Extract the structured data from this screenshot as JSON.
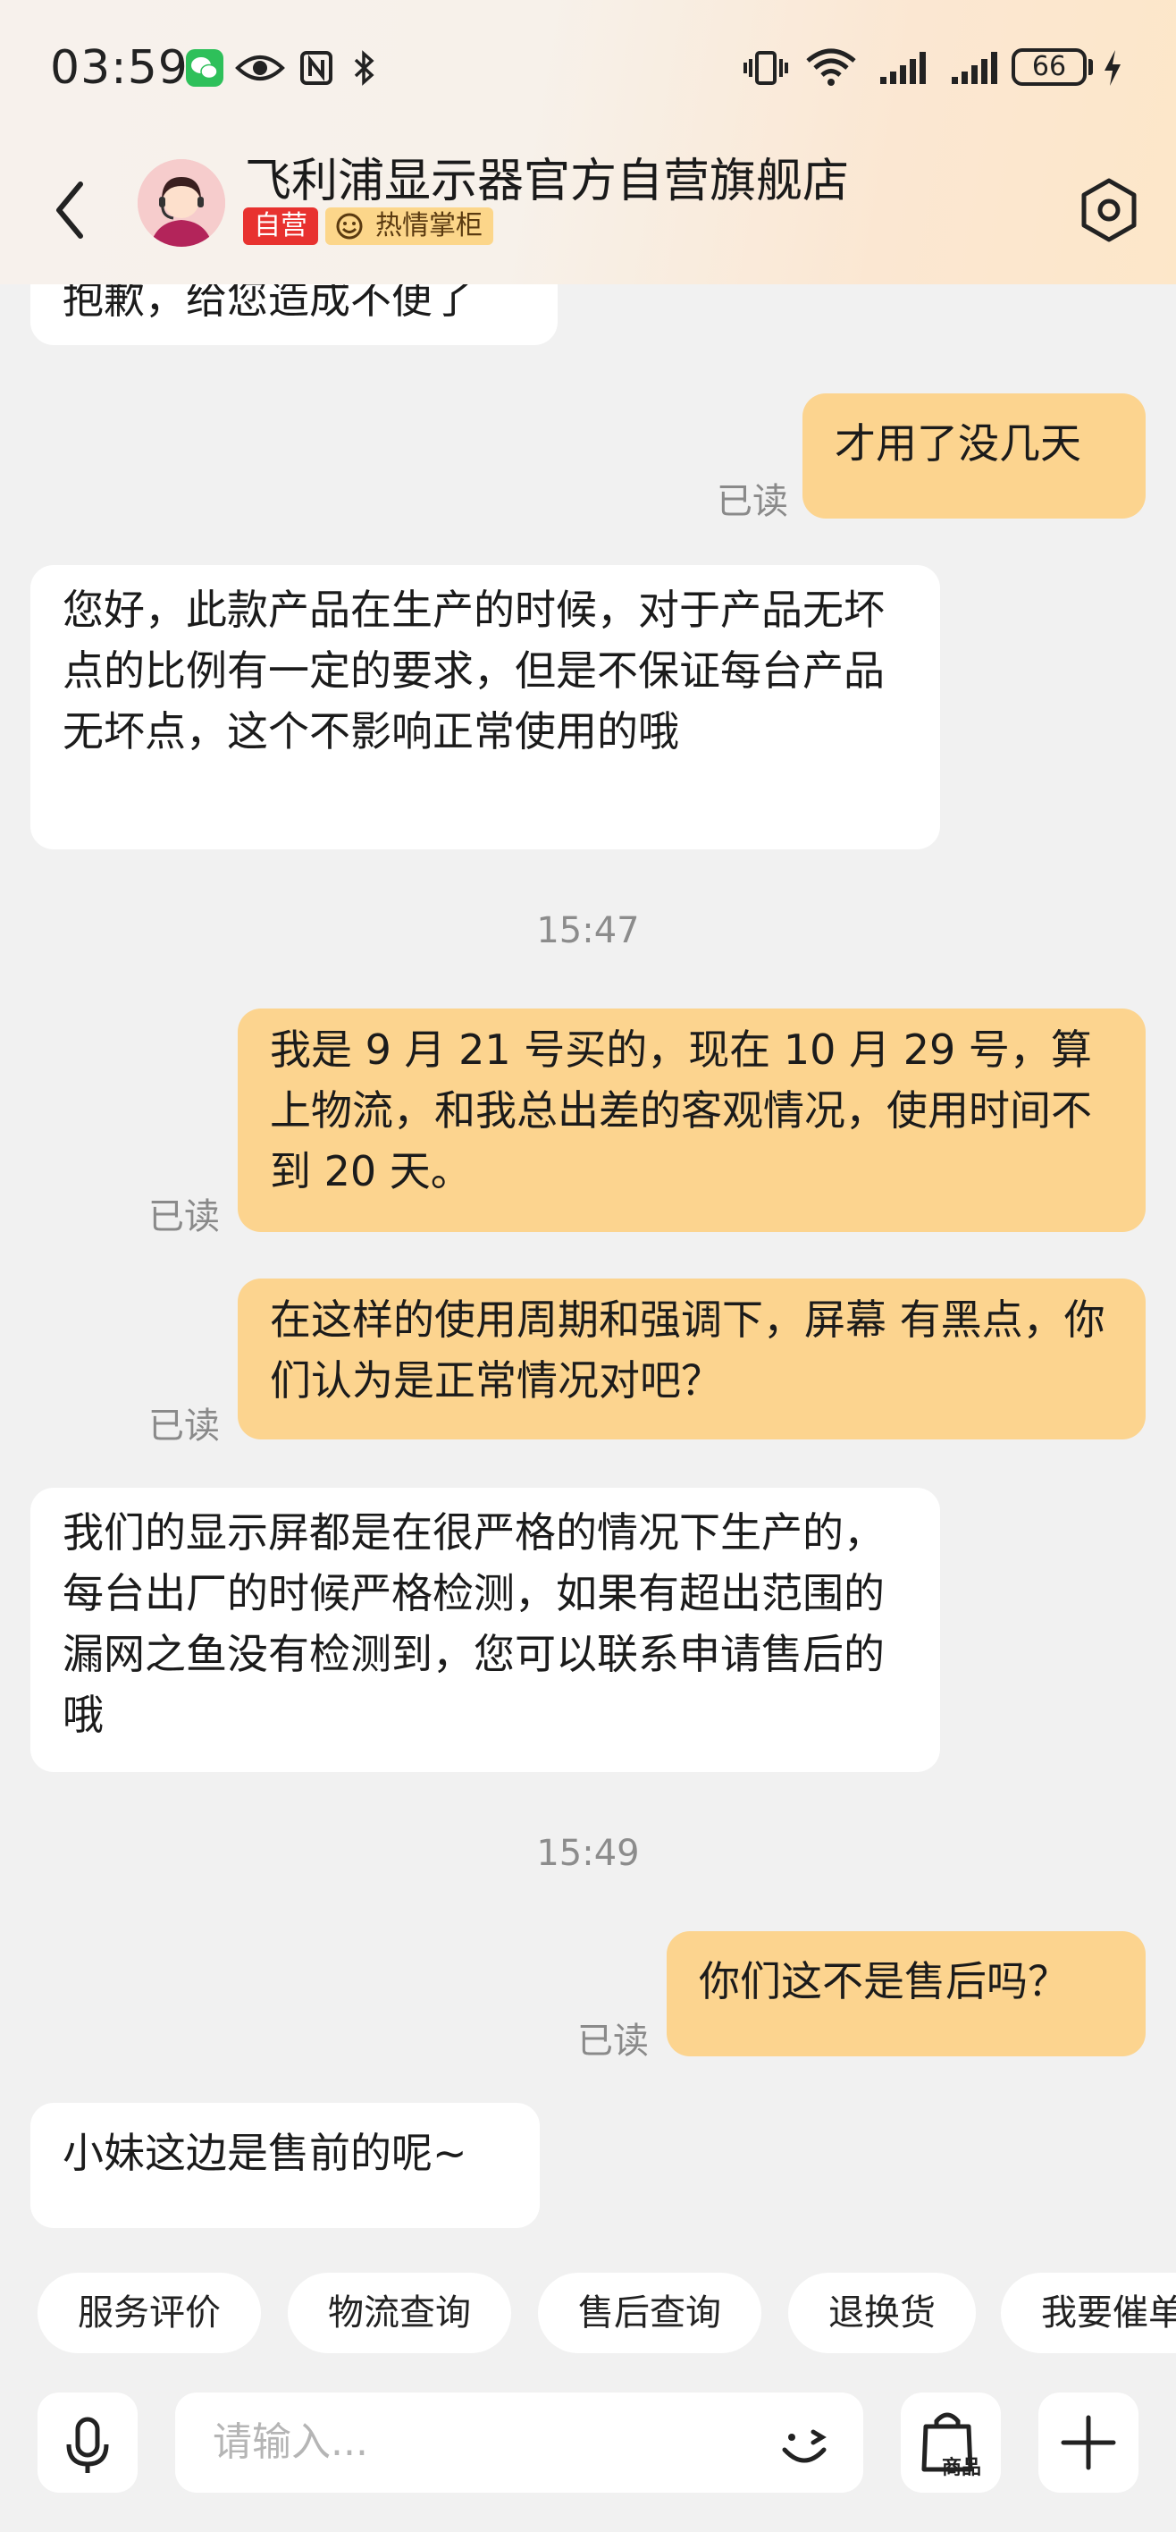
{
  "status_bar": {
    "time": "03:59",
    "battery": "66",
    "icons": [
      "wechat-icon",
      "eye-icon",
      "nfc-icon",
      "bluetooth-icon",
      "vibrate-icon",
      "wifi-icon",
      "signal-icon",
      "signal-icon",
      "charging-icon"
    ]
  },
  "header": {
    "title": "飞利浦显示器官方自营旗舰店",
    "badge_self": "自营",
    "badge_hot": "热情掌柜"
  },
  "messages": [
    {
      "side": "left",
      "text": "抱歉，给您造成不便了"
    },
    {
      "side": "right",
      "text": "才用了没几天",
      "read": "已读"
    },
    {
      "side": "left",
      "text": "您好，此款产品在生产的时候，对于产品无坏点的比例有一定的要求，但是不保证每台产品无坏点，这个不影响正常使用的哦"
    },
    {
      "type": "time",
      "text": "15:47"
    },
    {
      "side": "right",
      "text": "我是 9 月 21 号买的，现在 10 月 29 号，算上物流，和我总出差的客观情况，使用时间不到 20 天。",
      "read": "已读"
    },
    {
      "side": "right",
      "text": "在这样的使用周期和强调下，屏幕 有黑点，你们认为是正常情况对吧？",
      "read": "已读"
    },
    {
      "side": "left",
      "text": "我们的显示屏都是在很严格的情况下生产的，每台出厂的时候严格检测，如果有超出范围的漏网之鱼没有检测到，您可以联系申请售后的哦"
    },
    {
      "type": "time",
      "text": "15:49"
    },
    {
      "side": "right",
      "text": "你们这不是售后吗？",
      "read": "已读"
    },
    {
      "side": "left",
      "text": "小妹这边是售前的呢~"
    }
  ],
  "quick_actions": [
    "服务评价",
    "物流查询",
    "售后查询",
    "退换货",
    "我要催单"
  ],
  "input": {
    "placeholder": "请输入...",
    "goods_label": "商品"
  },
  "colors": {
    "my_bubble": "#fcd48f",
    "their_bubble": "#ffffff",
    "background": "#f1f1f1",
    "badge_self": "#e8322f",
    "badge_hot": "#fcd68a"
  }
}
